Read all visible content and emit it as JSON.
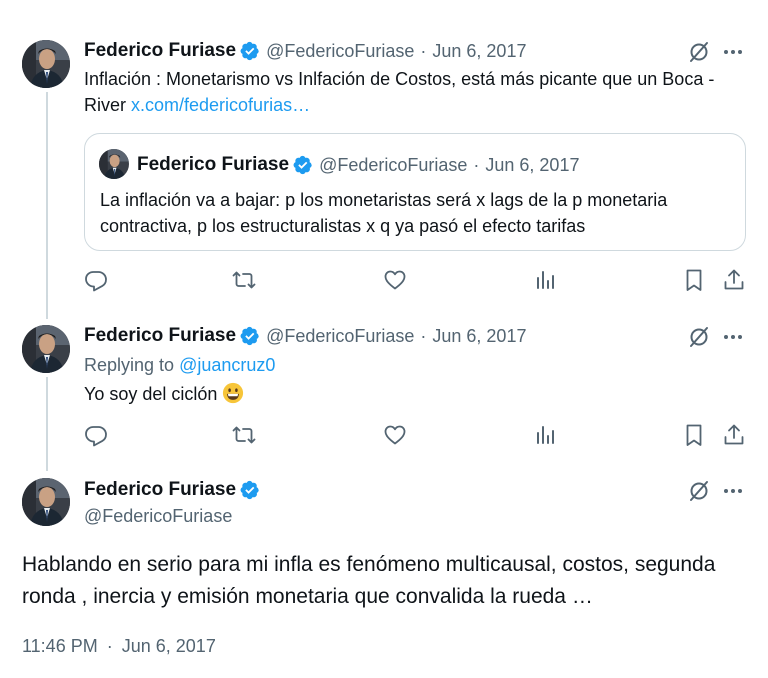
{
  "tweets": [
    {
      "name": "Federico Furiase",
      "handle": "@FedericoFuriase",
      "separator": "·",
      "date": "Jun 6, 2017",
      "text": "Inflación : Monetarismo vs Inlfación de Costos, está más picante que un Boca - River ",
      "link": "x.com/federicofurias…",
      "quote": {
        "name": "Federico Furiase",
        "handle": "@FedericoFuriase",
        "separator": "·",
        "date": "Jun 6, 2017",
        "text": "La inflación va a bajar: p los monetaristas será x lags de la p monetaria contractiva, p los estructuralistas x q ya pasó el efecto tarifas"
      }
    },
    {
      "name": "Federico Furiase",
      "handle": "@FedericoFuriase",
      "separator": "·",
      "date": "Jun 6, 2017",
      "replying_prefix": "Replying to ",
      "replying_to": "@juancruz0",
      "text": "Yo soy del ciclón ",
      "emoji": "grinning-face-emoji"
    }
  ],
  "main": {
    "name": "Federico Furiase",
    "handle": "@FedericoFuriase",
    "text": "Hablando en serio para mi infla es fenómeno multicausal, costos, segunda ronda , inercia y emisión monetaria que convalida la rueda …",
    "time": "11:46 PM",
    "separator": "·",
    "date": "Jun 6, 2017"
  },
  "icons": {
    "verified": "verified-badge-icon",
    "grok": "grok-icon",
    "more": "more-icon",
    "reply": "reply-icon",
    "repost": "repost-icon",
    "like": "like-icon",
    "views": "views-icon",
    "bookmark": "bookmark-icon",
    "share": "share-icon"
  },
  "colors": {
    "link": "#1d9bf0",
    "secondary_text": "#536471",
    "verified": "#1d9bf0",
    "border": "#cfd9de"
  }
}
